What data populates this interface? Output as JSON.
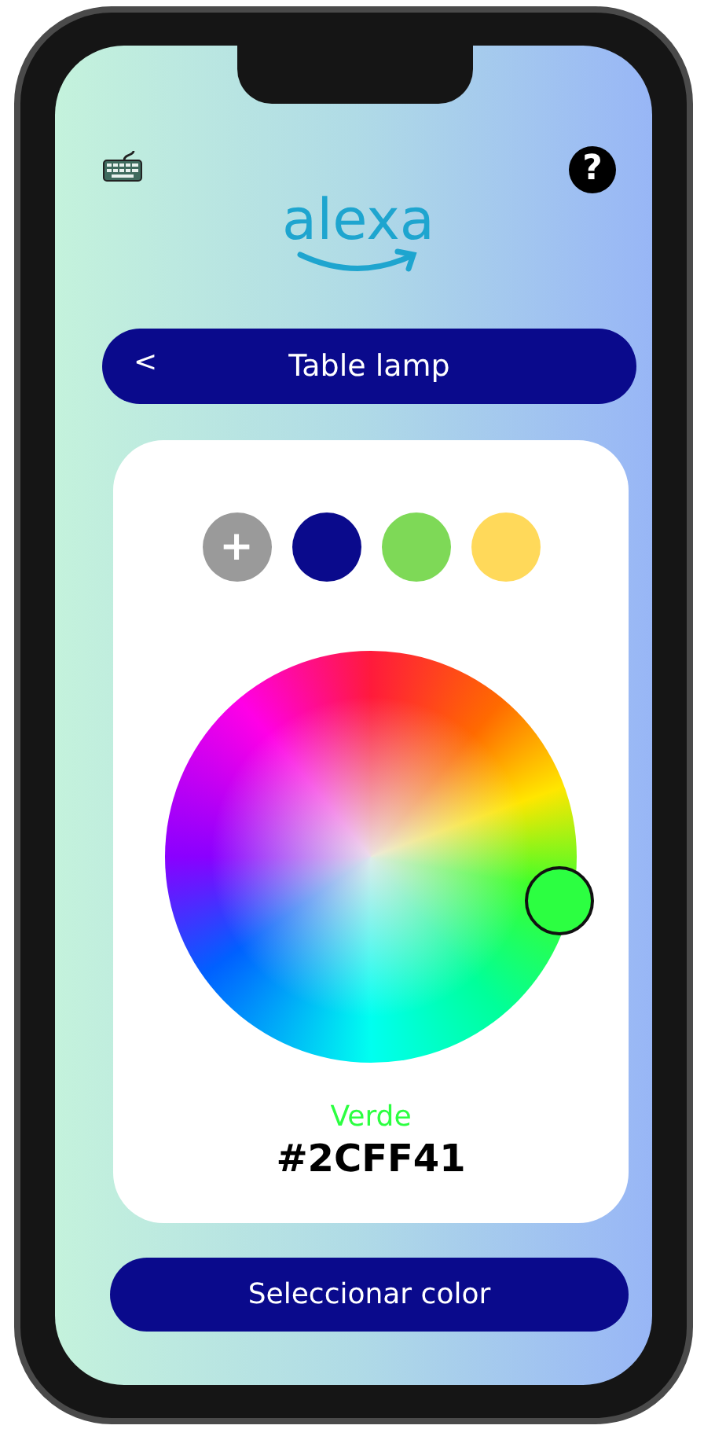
{
  "header": {
    "help_label": "?",
    "logo": "alexa"
  },
  "title_bar": {
    "back_label": "<",
    "title": "Table lamp"
  },
  "swatches": [
    {
      "kind": "add",
      "label": "+"
    },
    {
      "kind": "color",
      "color": "#0a0a8c"
    },
    {
      "kind": "color",
      "color": "#7ed957"
    },
    {
      "kind": "color",
      "color": "#ffd95a"
    }
  ],
  "picker": {
    "name": "Verde",
    "hex": "#2CFF41"
  },
  "action_button": "Seleccionar color"
}
